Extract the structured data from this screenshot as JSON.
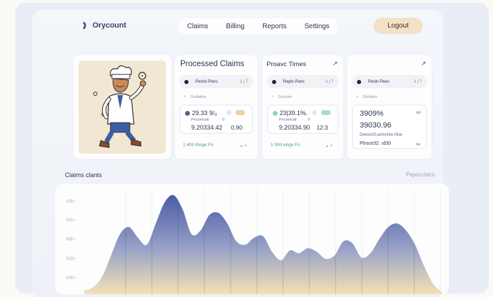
{
  "brand": {
    "name": "Orycount",
    "logo": "brand-logo-icon"
  },
  "nav": {
    "items": [
      "Claims",
      "Billing",
      "Reports",
      "Settings"
    ],
    "logout_label": "Logout"
  },
  "cards": [
    {
      "title": "Processed Claims",
      "pill": {
        "label": "Pechn Pens",
        "value": "1 | 7"
      },
      "sub_label": "Cediation",
      "stat": {
        "primary": "29.33 9/₀",
        "secondary_label": "Pecoelcatr",
        "secondary_value": "9.20334.42",
        "side_mark": "0",
        "side_value": "0.90"
      },
      "link": "1 400 Kioge Fo",
      "chevrons": "⌄ ›"
    },
    {
      "title": "Proavc Times",
      "arrow": "↗",
      "pill": {
        "label": "Repin Pans",
        "value": "1 | 7"
      },
      "sub_label": "Cecluire",
      "stat": {
        "primary": "23|39.1%.",
        "secondary_label": "Pecoelcatr",
        "secondary_value": "9.20334.90",
        "side_mark": "0",
        "side_value": "12:3"
      },
      "link": "1 000 kingv Fo",
      "chevrons": "⌄ ›"
    },
    {
      "title": "",
      "arrow": "↗",
      "pill": {
        "label": "Peoin Pees",
        "value": "1 | 7"
      },
      "sub_label": "Diciluion",
      "stat": {
        "line1": "3909%",
        "line2": "39030.96",
        "line3": "Deesnc0.actnchre rfice",
        "line4": "Plroce32. ıd30",
        "side1": "tdt",
        "side2": "be"
      }
    }
  ],
  "chart_section": {
    "title": "Claims clants",
    "right_label": "Pepocclairs"
  },
  "chart_data": {
    "type": "area",
    "title": "Claims clants",
    "y_tick_labels": [
      "109",
      "102",
      "930",
      "013",
      "109"
    ],
    "x": [
      0,
      1,
      2,
      3,
      4,
      5,
      6,
      7,
      8,
      9,
      10,
      11,
      12,
      13,
      14,
      15,
      16,
      17,
      18,
      19,
      20,
      21,
      22,
      23,
      24,
      25,
      26,
      27,
      28,
      29,
      30,
      31,
      32,
      33,
      34,
      35,
      36,
      37,
      38,
      39,
      40
    ],
    "values": [
      5,
      10,
      25,
      55,
      85,
      95,
      80,
      70,
      100,
      130,
      140,
      120,
      85,
      90,
      112,
      115,
      100,
      75,
      70,
      80,
      82,
      60,
      48,
      62,
      58,
      65,
      60,
      50,
      55,
      75,
      72,
      52,
      58,
      78,
      95,
      100,
      90,
      70,
      40,
      15,
      3
    ],
    "ylim": [
      0,
      150
    ],
    "grid": true,
    "colors": {
      "top": "#4a5ca6",
      "bottom": "#f4e2b4"
    }
  }
}
